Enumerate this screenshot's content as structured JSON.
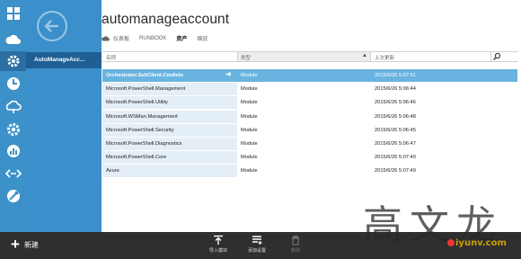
{
  "nav": {
    "icons": [
      "grid-icon",
      "cloud-icon",
      "automation-gear-icon",
      "clock-icon",
      "cloud-sync-icon",
      "settings-icon",
      "analytics-icon",
      "network-icon",
      "tools-icon"
    ],
    "active_index": 2
  },
  "panel": {
    "selected_item": "AutoManageAcc..."
  },
  "header": {
    "title": "automanageaccount"
  },
  "tabs": [
    {
      "label": "仪表板"
    },
    {
      "label": "RUNBOOK"
    },
    {
      "label": "资产"
    },
    {
      "label": "缩放"
    }
  ],
  "active_tab": 2,
  "table": {
    "columns": [
      "名称",
      "类型",
      "上次更新"
    ],
    "rows": [
      {
        "name": "Orchestrator.SshClient.Cmdlets",
        "type": "Module",
        "updated": "2015/6/26 5:07:51"
      },
      {
        "name": "Microsoft.PowerShell.Management",
        "type": "Module",
        "updated": "2015/6/26 5:06:44"
      },
      {
        "name": "Microsoft.PowerShell.Utility",
        "type": "Module",
        "updated": "2015/6/26 5:06:46"
      },
      {
        "name": "Microsoft.WSMan.Management",
        "type": "Module",
        "updated": "2015/6/26 5:06:48"
      },
      {
        "name": "Microsoft.PowerShell.Security",
        "type": "Module",
        "updated": "2015/6/26 5:06:45"
      },
      {
        "name": "Microsoft.PowerShell.Diagnostics",
        "type": "Module",
        "updated": "2015/6/26 5:06:47"
      },
      {
        "name": "Microsoft.PowerShell.Core",
        "type": "Module",
        "updated": "2015/6/26 5:07:40"
      },
      {
        "name": "Azure",
        "type": "Module",
        "updated": "2015/6/26 5:07:49"
      }
    ],
    "selected_row": 0
  },
  "bottom_bar": {
    "new_label": "新建",
    "commands": [
      {
        "label": "导入模块",
        "icon": "import-icon",
        "enabled": true
      },
      {
        "label": "添加设置",
        "icon": "add-setting-icon",
        "enabled": true
      },
      {
        "label": "删除",
        "icon": "delete-icon",
        "enabled": false
      }
    ]
  },
  "watermark": {
    "chars": "高文龙",
    "url": "iyunv.com"
  },
  "colors": {
    "rail": "#3d91c9",
    "panel": "#3b8fca",
    "selected_item": "#1f5f94",
    "selected_row": "#69b4e0",
    "row_tint": "#e4eef7",
    "bottom_bar": "#2f2f2f"
  }
}
